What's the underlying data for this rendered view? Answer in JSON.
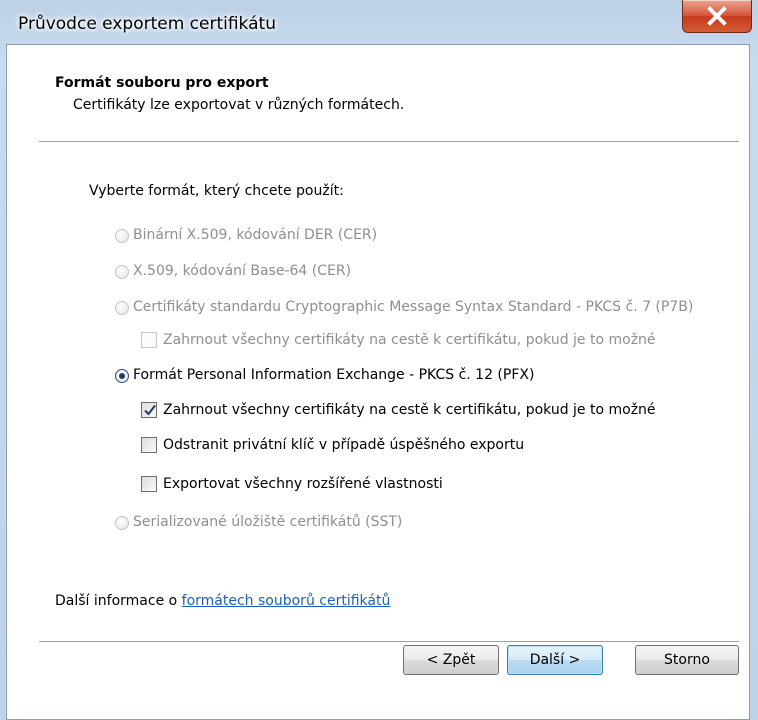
{
  "window": {
    "title": "Průvodce exportem certifikátu"
  },
  "header": {
    "title": "Formát souboru pro export",
    "subtitle": "Certifikáty lze exportovat v různých formátech."
  },
  "prompt": "Vyberte formát, který chcete použít:",
  "options": {
    "der": {
      "label": "Binární X.509, kódování DER (CER)",
      "selected": false,
      "enabled": false
    },
    "base64": {
      "label": "X.509, kódování Base-64 (CER)",
      "selected": false,
      "enabled": false
    },
    "p7b": {
      "label": "Certifikáty standardu Cryptographic Message Syntax Standard - PKCS č. 7 (P7B)",
      "selected": false,
      "enabled": false
    },
    "p7b_include": {
      "label": "Zahrnout všechny certifikáty na cestě k certifikátu, pokud je to možné",
      "checked": false,
      "enabled": false
    },
    "pfx": {
      "label": "Formát Personal Information Exchange - PKCS č. 12 (PFX)",
      "selected": true,
      "enabled": true
    },
    "pfx_include": {
      "label": "Zahrnout všechny certifikáty na cestě k certifikátu, pokud je to možné",
      "checked": true,
      "enabled": true
    },
    "pfx_delete_key": {
      "label": "Odstranit privátní klíč v případě úspěšného exportu",
      "checked": false,
      "enabled": true
    },
    "pfx_export_props": {
      "label": "Exportovat všechny rozšířené vlastnosti",
      "checked": false,
      "enabled": true
    },
    "sst": {
      "label": "Serializované úložiště certifikátů (SST)",
      "selected": false,
      "enabled": false
    }
  },
  "more_info": {
    "prefix": "Další informace o ",
    "link": "formátech souborů certifikátů"
  },
  "buttons": {
    "back": "< Zpět",
    "next": "Další >",
    "cancel": "Storno"
  },
  "colors": {
    "link": "#1d5fbf",
    "disabled_text": "#8f8f8f",
    "close_button": "#c43b1c",
    "default_button": "#bddcf2"
  }
}
